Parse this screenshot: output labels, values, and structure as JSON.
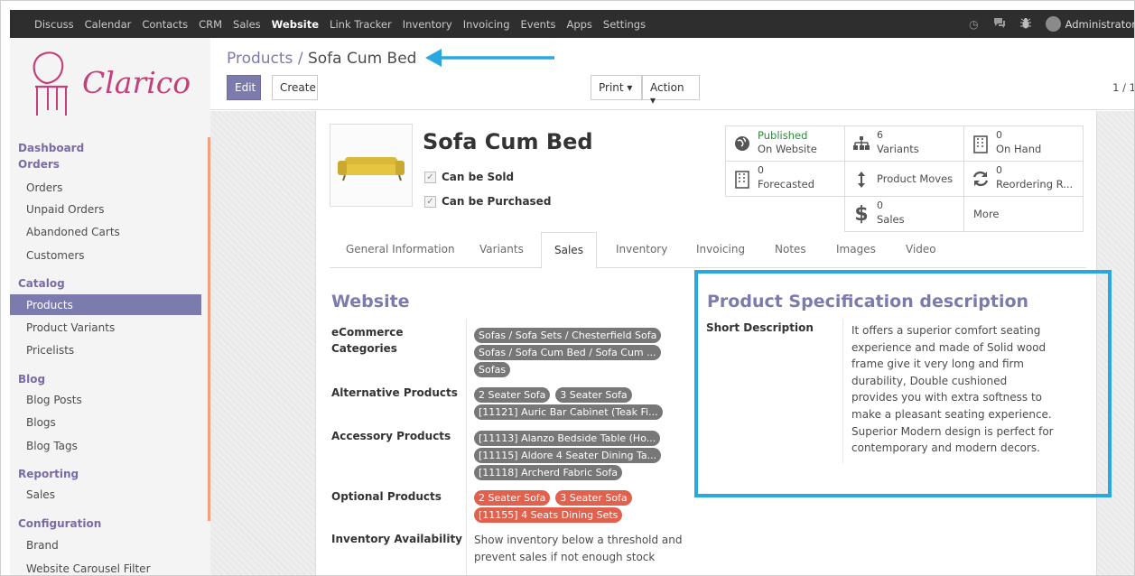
{
  "topbar": {
    "menu": [
      "Discuss",
      "Calendar",
      "Contacts",
      "CRM",
      "Sales",
      "Website",
      "Link Tracker",
      "Inventory",
      "Invoicing",
      "Events",
      "Apps",
      "Settings"
    ],
    "active": "Website",
    "user": "Administrator"
  },
  "sidebar": {
    "brand": "Clarico",
    "dashboard": "Dashboard",
    "orders_h": "Orders",
    "orders_items": [
      "Orders",
      "Unpaid Orders",
      "Abandoned Carts",
      "Customers"
    ],
    "catalog_h": "Catalog",
    "catalog_items": [
      "Products",
      "Product Variants",
      "Pricelists"
    ],
    "blog_h": "Blog",
    "blog_items": [
      "Blog Posts",
      "Blogs",
      "Blog Tags"
    ],
    "reporting_h": "Reporting",
    "reporting_items": [
      "Sales"
    ],
    "config_h": "Configuration",
    "config_items": [
      "Brand",
      "Website Carousel Filter"
    ]
  },
  "control": {
    "breadcrumb_parent": "Products",
    "breadcrumb_sep": "/",
    "breadcrumb_current": "Sofa Cum Bed",
    "edit": "Edit",
    "create": "Create",
    "print": "Print ▾",
    "action": "Action ▾",
    "pager": "1 / 1"
  },
  "product": {
    "name": "Sofa Cum Bed",
    "can_be_sold": "Can be Sold",
    "can_be_purchased": "Can be Purchased"
  },
  "stats": {
    "published_1": "Published",
    "published_2": "On Website",
    "variants_num": "6",
    "variants_lbl": "Variants",
    "onhand_num": "0",
    "onhand_lbl": "On Hand",
    "forecast_num": "0",
    "forecast_lbl": "Forecasted",
    "moves_lbl": "Product Moves",
    "reorder_num": "0",
    "reorder_lbl": "Reordering R...",
    "sales_num": "0",
    "sales_lbl": "Sales",
    "more": "More"
  },
  "tabs": [
    "General Information",
    "Variants",
    "Sales",
    "Inventory",
    "Invoicing",
    "Notes",
    "Images",
    "Video"
  ],
  "website": {
    "heading": "Website",
    "ecom_label": "eCommerce Categories",
    "ecom_tags": [
      "Sofas / Sofa Sets / Chesterfield Sofa",
      "Sofas / Sofa Cum Bed / Sofa Cum ...",
      "Sofas"
    ],
    "alt_label": "Alternative Products",
    "alt_tags": [
      "2 Seater Sofa",
      "3 Seater Sofa",
      "[11121] Auric Bar Cabinet (Teak Fi..."
    ],
    "acc_label": "Accessory Products",
    "acc_tags": [
      "[11113] Alanzo Bedside Table (Ho...",
      "[11115] Aldore 4 Seater Dining Ta...",
      "[11118] Archerd Fabric Sofa"
    ],
    "opt_label": "Optional Products",
    "opt_tags": [
      "2 Seater Sofa",
      "3 Seater Sofa",
      "[11155] 4 Seats Dining Sets"
    ],
    "inv_label": "Inventory Availability",
    "inv_text": "Show inventory below a threshold and prevent sales if not enough stock"
  },
  "spec": {
    "heading": "Product Specification description",
    "short_label": "Short Description",
    "short_text": "It offers a superior comfort seating experience and made of Solid wood frame give it very long and firm durability, Double cushioned provides you with extra softness to make a pleasant seating experience. Superior Modern design is perfect for contemporary and modern decors."
  },
  "colors": {
    "accent": "#7c7bad",
    "topbar": "#2e2e2e",
    "highlight": "#29a8e0",
    "tag_grey": "#777777",
    "tag_red": "#e0614d"
  },
  "icons": [
    "clock-icon",
    "chat-icon",
    "bug-icon",
    "globe-icon",
    "sitemap-icon",
    "building-icon",
    "arrows-vertical-icon",
    "refresh-icon",
    "dollar-icon"
  ]
}
